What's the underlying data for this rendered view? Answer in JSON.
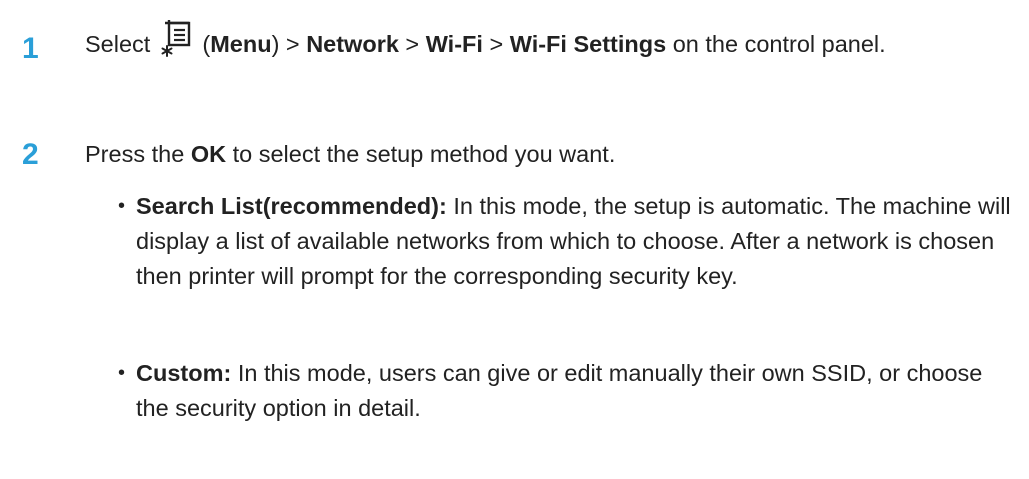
{
  "step1": {
    "number": "1",
    "text_before_icon": "Select",
    "icon": "menu-icon",
    "menu_label": "Menu",
    "network": "Network",
    "wifi": "Wi-Fi",
    "wifi_settings": "Wi-Fi Settings",
    "text_after": "on the control panel."
  },
  "step2": {
    "number": "2",
    "text_before": "Press the",
    "ok": "OK",
    "text_after": "to select the setup method you want."
  },
  "bullets": [
    {
      "bullet": "•",
      "title": "Search List(recommended):",
      "text": "In this mode, the setup is automatic. The machine will display a list of available networks from which to choose. After a network is chosen then printer will prompt for the corresponding security key."
    },
    {
      "bullet": "•",
      "title": "Custom:",
      "text": "In this mode, users can give or edit manually their own SSID, or choose the security option in detail."
    }
  ],
  "colors": {
    "step_number": "#2a9fd8",
    "text": "#222222"
  }
}
